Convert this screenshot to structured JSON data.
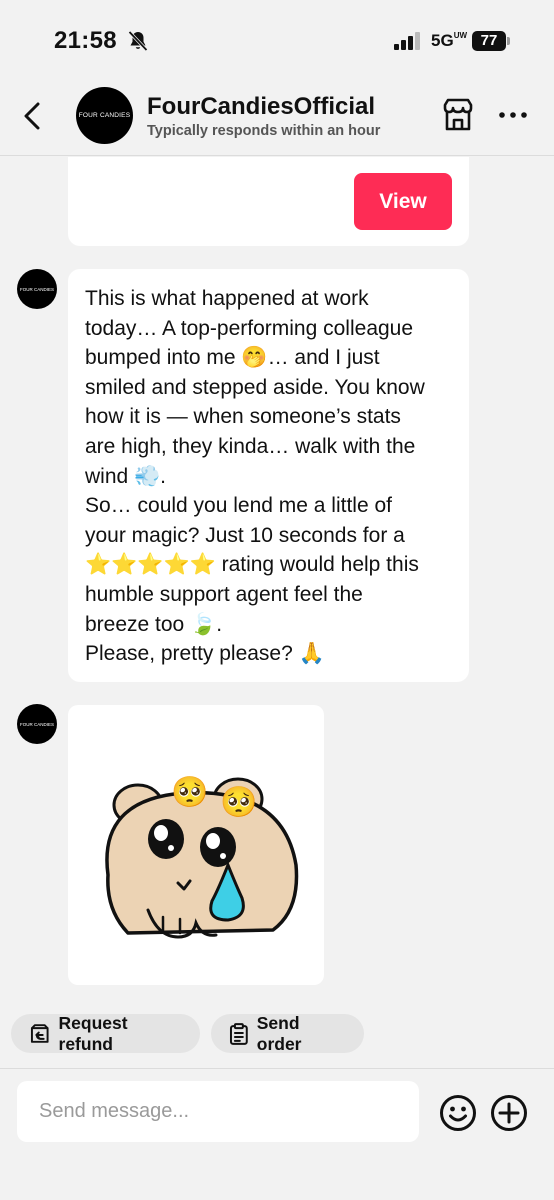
{
  "status_bar": {
    "time": "21:58",
    "network": "5G",
    "network_sub": "UW",
    "battery": "77"
  },
  "header": {
    "avatar_text": "FOUR CANDIES",
    "shop_name": "FourCandiesOfficial",
    "subtitle": "Typically responds within an hour"
  },
  "messages": {
    "card_button": "View",
    "avatar_text": "FOUR CANDIES",
    "text_lines": [
      "This is what happened at work",
      "today… A top-performing colleague",
      "bumped into me 🤭… and I just",
      "smiled and stepped aside. You know",
      "how it is — when someone’s stats",
      "are high, they kinda… walk with the",
      "wind 💨.",
      "So… could you lend me a little of",
      "your magic? Just 10 seconds for a",
      "⭐⭐⭐⭐⭐ rating would help this",
      "humble support agent feel the",
      "breeze too 🍃.",
      "Please, pretty please? 🙏"
    ],
    "sticker_emoji": "🥺"
  },
  "quick_actions": {
    "refund": "Request refund",
    "order": "Send order"
  },
  "input": {
    "placeholder": "Send message..."
  },
  "colors": {
    "accent": "#fe2c55",
    "background": "#f2f2f2",
    "bubble": "#ffffff",
    "chip": "#e4e4e4",
    "sticker_body": "#ecd3b4",
    "tear": "#3ecfe6"
  },
  "icons": [
    "bell-slash-icon",
    "signal-icon",
    "battery-icon",
    "back-chevron-icon",
    "store-icon",
    "more-dots-icon",
    "refund-box-icon",
    "clipboard-icon",
    "emoji-icon",
    "plus-icon"
  ]
}
